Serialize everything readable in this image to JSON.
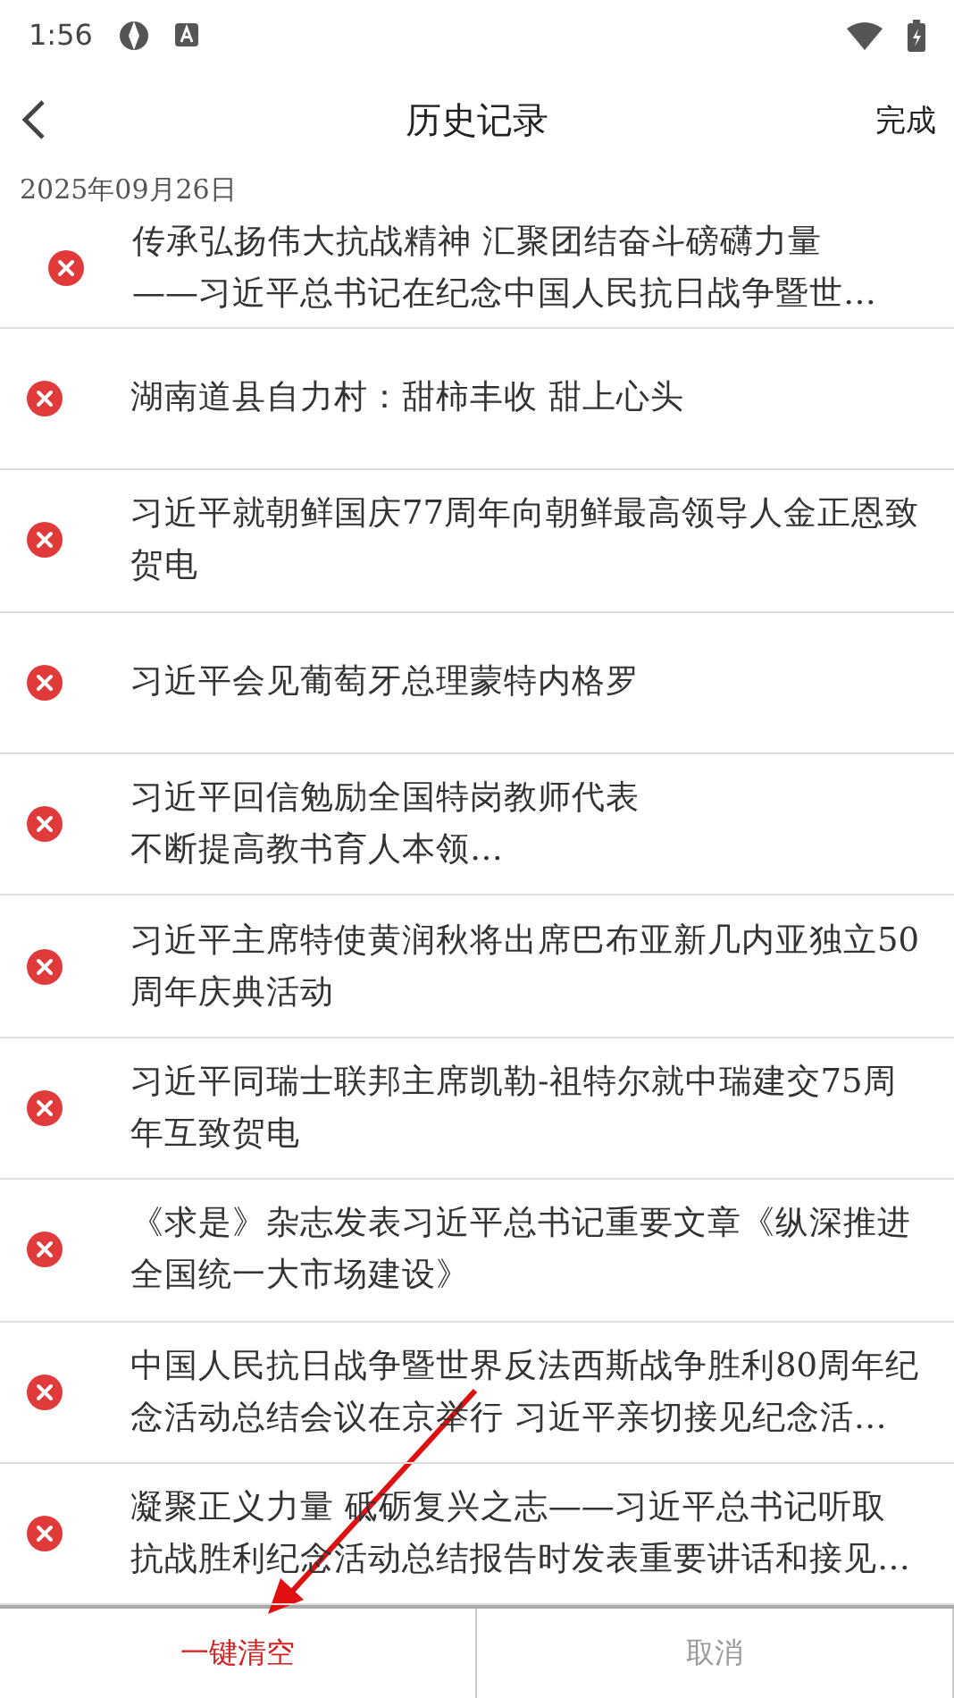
{
  "status_bar": {
    "time": "1:56"
  },
  "header": {
    "title": "历史记录",
    "action": "完成"
  },
  "date": "2025年09月26日",
  "items": [
    {
      "lines": [
        "传承弘扬伟大抗战精神  汇聚团结奋斗磅礴力量",
        "——习近平总书记在纪念中国人民抗日战争暨世…"
      ]
    },
    {
      "lines": [
        "湖南道县自力村：甜柿丰收  甜上心头"
      ]
    },
    {
      "lines": [
        "习近平就朝鲜国庆77周年向朝鲜最高领导人金正恩致",
        "贺电"
      ]
    },
    {
      "lines": [
        "习近平会见葡萄牙总理蒙特内格罗"
      ]
    },
    {
      "lines": [
        "习近平回信勉励全国特岗教师代表",
        "不断提高教书育人本领…"
      ]
    },
    {
      "lines": [
        "习近平主席特使黄润秋将出席巴布亚新几内亚独立50",
        "周年庆典活动"
      ]
    },
    {
      "lines": [
        "习近平同瑞士联邦主席凯勒-祖特尔就中瑞建交75周",
        "年互致贺电"
      ]
    },
    {
      "lines": [
        "《求是》杂志发表习近平总书记重要文章《纵深推进",
        "全国统一大市场建设》"
      ]
    },
    {
      "lines": [
        "中国人民抗日战争暨世界反法西斯战争胜利80周年纪",
        "念活动总结会议在京举行  习近平亲切接见纪念活…"
      ]
    },
    {
      "lines": [
        "凝聚正义力量  砥砺复兴之志——习近平总书记听取",
        "抗战胜利纪念活动总结报告时发表重要讲话和接见…"
      ]
    }
  ],
  "footer": {
    "buttons": [
      {
        "label": "一键清空",
        "kind": "danger"
      },
      {
        "label": "取消",
        "kind": "muted"
      }
    ]
  }
}
